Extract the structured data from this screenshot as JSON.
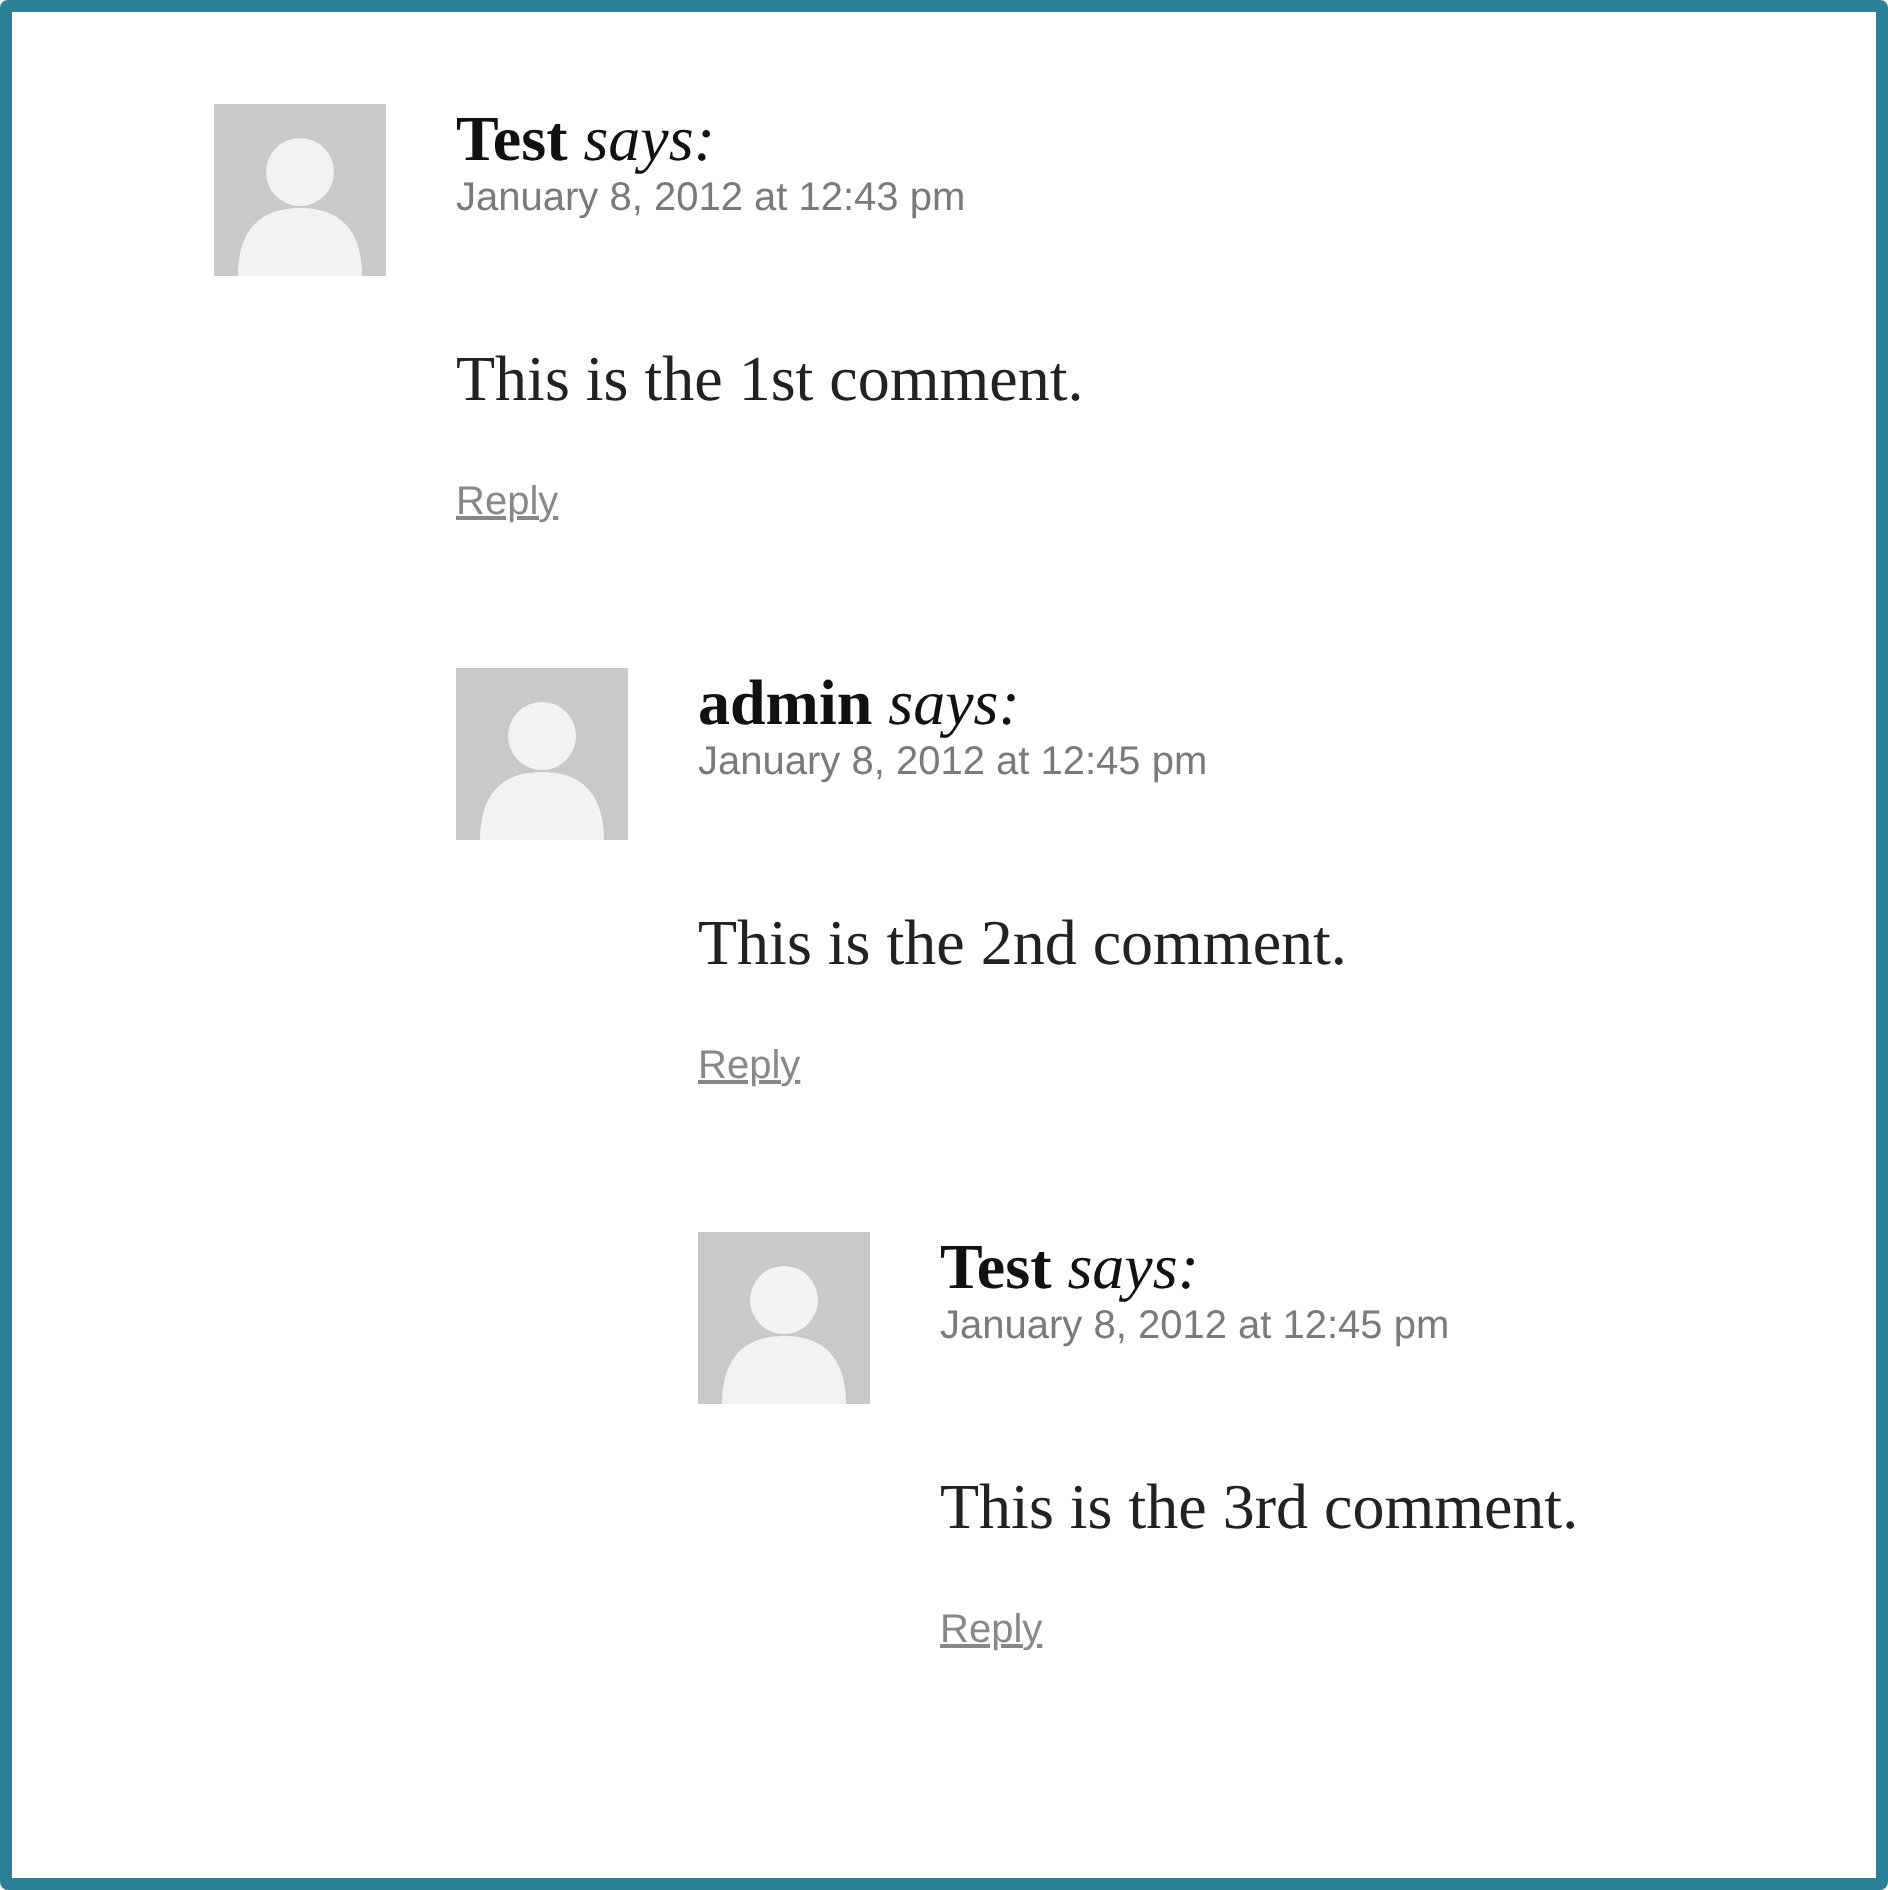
{
  "comments": [
    {
      "author": "Test",
      "says": "says:",
      "date": "January 8, 2012 at 12:43 pm",
      "text": "This is the 1st comment.",
      "reply": "Reply",
      "children": [
        {
          "author": "admin",
          "says": "says:",
          "date": "January 8, 2012 at 12:45 pm",
          "text": "This is the 2nd comment.",
          "reply": "Reply",
          "children": [
            {
              "author": "Test",
              "says": "says:",
              "date": "January 8, 2012 at 12:45 pm",
              "text": "This is the 3rd comment.",
              "reply": "Reply"
            }
          ]
        }
      ]
    }
  ]
}
